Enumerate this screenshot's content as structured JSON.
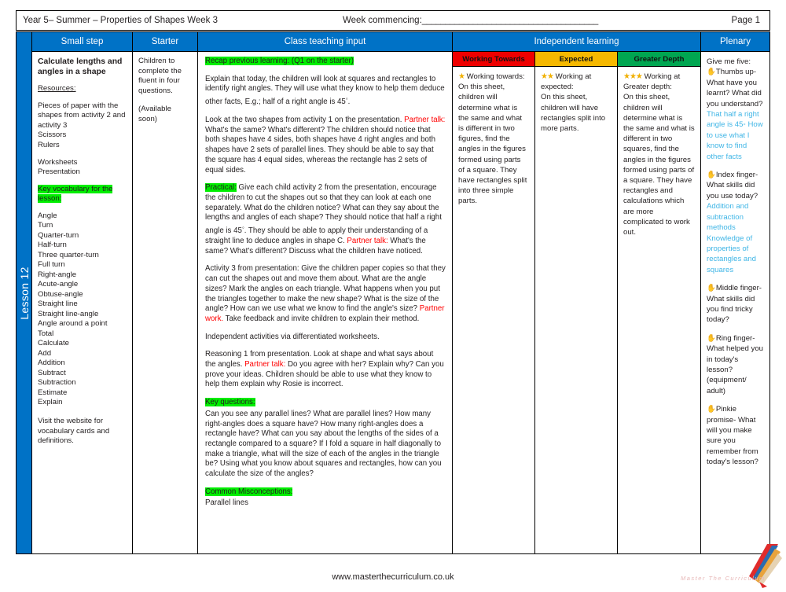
{
  "header": {
    "title": "Year 5– Summer – Properties of Shapes Week 3",
    "week_commencing_label": "Week commencing:",
    "week_commencing_rule": "______________________________________",
    "page_label": "Page 1"
  },
  "lesson_tab": {
    "label": "Lesson 12"
  },
  "columns": {
    "small_step": "Small step",
    "starter": "Starter",
    "class_teaching_input": "Class teaching input",
    "independent_learning": "Independent learning",
    "plenary": "Plenary"
  },
  "small_step": {
    "title": "Calculate lengths and angles in a shape",
    "resources_label": "Resources:",
    "resources": [
      "Pieces of paper with the shapes from activity 2 and activity 3",
      "Scissors",
      "Rulers"
    ],
    "materials": [
      "Worksheets",
      "Presentation"
    ],
    "vocab_heading": "Key vocabulary for the lesson:",
    "vocabulary": [
      "Angle",
      "Turn",
      "Quarter-turn",
      "Half-turn",
      "Three quarter-turn",
      "Full turn",
      "Right-angle",
      "Acute-angle",
      "Obtuse-angle",
      "Straight line",
      "Straight line-angle",
      "Angle around a point",
      "Total",
      "Calculate",
      "Add",
      "Addition",
      "Subtract",
      "Subtraction",
      "Estimate",
      "Explain"
    ],
    "visit_note": "Visit the website for vocabulary cards and definitions."
  },
  "starter": {
    "paragraph_1": "Children to complete the fluent in four questions.",
    "paragraph_2": "(Available soon)"
  },
  "teaching": {
    "recap_heading": "Recap previous learning: (Q1 on the starter)",
    "p1_a": "Explain that today, the children will look at squares and rectangles to identify right angles. They will use what they know to help them deduce other facts, E.g.; half of a right angle is 45",
    "p1_deg": "◦",
    "p1_b": ".",
    "p2_a": "Look at the two shapes from activity 1 on the presentation. ",
    "p2_red": "Partner talk:",
    "p2_b": " What's the same? What's different? The children should notice that both shapes have 4 sides, both shapes have 4 right angles and both shapes have 2 sets of parallel lines. They should be able to say that the square has 4 equal sides, whereas the rectangle has 2 sets of equal sides.",
    "p3_hl": "Practical:",
    "p3_a": " Give each child activity 2 from the presentation, encourage the children to cut the shapes out so that they can look at each one separately. What do the children notice? What can they say about the lengths and angles of each shape? They should notice that half a right angle is 45",
    "p3_deg": "◦",
    "p3_b": ". They should be able to apply their understanding of a straight line to deduce angles in shape C. ",
    "p3_red": "Partner talk:",
    "p3_c": " What's the same? What's different? Discuss what the children have noticed.",
    "p4_a": "Activity 3 from presentation: Give the children paper copies so that they can cut the shapes out and move them about. What are the angle sizes? Mark the angles on each triangle. What happens when you put the triangles together to make the new shape? What is the size of the angle? How can we use what we know to find the angle's size? ",
    "p4_red": "Partner work.",
    "p4_b": " Take feedback and invite children to explain their method.",
    "p5": "Independent activities via differentiated worksheets.",
    "p6_a": "Reasoning 1 from presentation. Look at shape and what says about the angles. ",
    "p6_red": "Partner talk:",
    "p6_b": " Do you agree with her? Explain why? Can you prove your ideas. Children should be able to use what they know to help them explain why Rosie is incorrect.",
    "key_questions_heading": "Key questions:",
    "key_questions_body": "Can you see any parallel lines? What are parallel lines? How many right-angles does a square have? How many right-angles does a rectangle have? What can you say about the lengths of the sides of a rectangle compared to a square? If I fold a square in half diagonally to make a triangle, what will the size of each of the angles in the triangle be? Using what you know about squares and rectangles, how can you calculate the size of the angles?",
    "misconceptions_heading": "Common Misconceptions:",
    "misconceptions_body": "Parallel lines"
  },
  "independent": {
    "groups": [
      {
        "header": "Working Towards",
        "header_color": "#ee0000",
        "stars": "★",
        "lead": "Working towards:",
        "body": "On this sheet, children will determine what is the same and what is different in two figures, find the angles in the figures formed using parts of a square. They have rectangles split into three simple parts."
      },
      {
        "header": "Expected",
        "header_color": "#f5b800",
        "stars": "★★",
        "lead": "Working at expected:",
        "body": "On this sheet, children will have rectangles split into more parts."
      },
      {
        "header": "Greater Depth",
        "header_color": "#00a651",
        "stars": "★★★",
        "lead": "Working at Greater depth:",
        "body": "On this sheet, children will determine what is the same and what is different in two squares, find the angles in the figures formed using parts of a square. They have rectangles and calculations which are more complicated to work out."
      }
    ]
  },
  "plenary": {
    "intro": "Give me five:",
    "items": [
      {
        "hand": "✋",
        "question": "Thumbs up- What have you learnt? What did you understand?",
        "answer": "That half a right angle is 45◦ How to use what I know to find other facts"
      },
      {
        "hand": "✋",
        "question": "Index finger- What skills did you use today?",
        "answer": "Addition and subtraction methods Knowledge of properties of rectangles and squares"
      },
      {
        "hand": "✋",
        "question": "Middle finger- What skills did you find tricky today?",
        "answer": ""
      },
      {
        "hand": "✋",
        "question": "Ring finger- What helped you in today's lesson? (equipment/ adult)",
        "answer": ""
      },
      {
        "hand": "✋",
        "question": "Pinkie promise- What will you make sure you remember from today's lesson?",
        "answer": ""
      }
    ]
  },
  "footer": {
    "url": "www.masterthecurriculum.co.uk",
    "logo_text": "Master The Curriculum"
  }
}
